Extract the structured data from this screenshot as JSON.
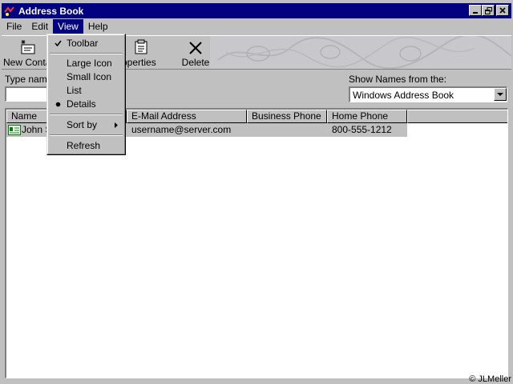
{
  "window": {
    "title": "Address Book"
  },
  "menubar": {
    "items": [
      "File",
      "Edit",
      "View",
      "Help"
    ],
    "active": "View"
  },
  "toolbar": {
    "new_contact": "New Conta",
    "properties": "roperties",
    "delete": "Delete"
  },
  "search": {
    "label": "Type name",
    "value": ""
  },
  "show_names": {
    "label": "Show Names from the:",
    "value": "Windows Address Book"
  },
  "list": {
    "columns": [
      "Name",
      "E-Mail Address",
      "Business Phone",
      "Home Phone"
    ],
    "rows": [
      {
        "name": "John S",
        "email": "username@server.com",
        "business_phone": "",
        "home_phone": "800-555-1212"
      }
    ]
  },
  "view_menu": {
    "items": {
      "toolbar": "Toolbar",
      "large_icon": "Large Icon",
      "small_icon": "Small Icon",
      "list": "List",
      "details": "Details",
      "sort_by": "Sort by",
      "refresh": "Refresh"
    }
  },
  "footer": {
    "copyright": "© JLMeller"
  },
  "colors": {
    "titlebar": "#000080",
    "face": "#c0c0c0",
    "highlight": "#000080"
  }
}
